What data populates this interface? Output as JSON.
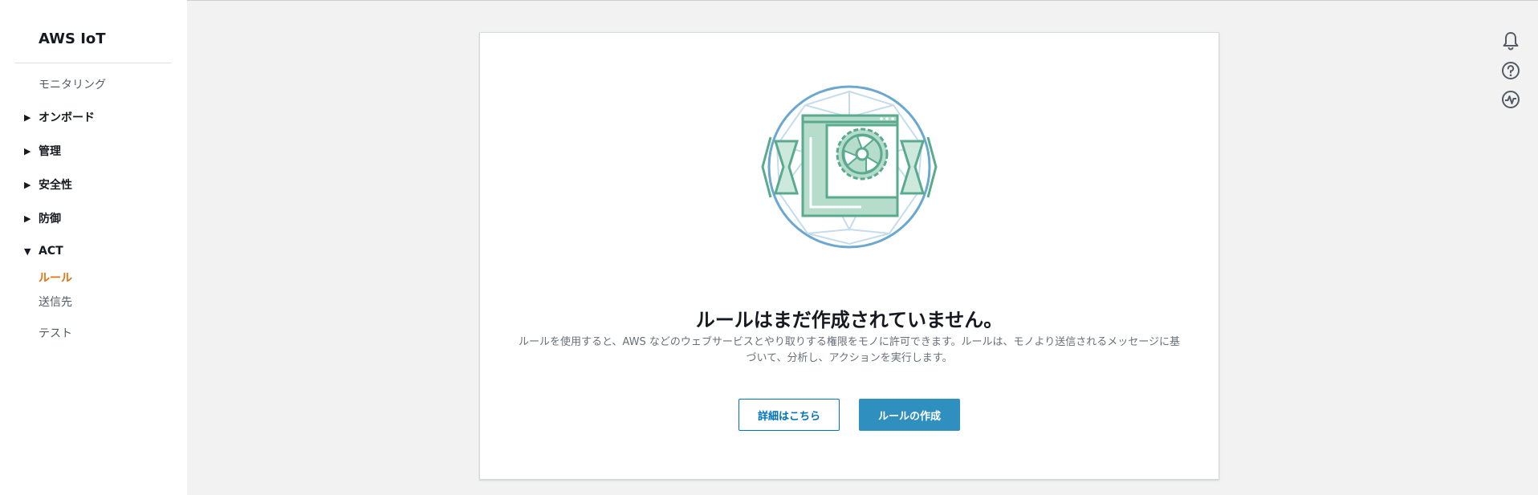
{
  "app": {
    "title": "AWS IoT"
  },
  "sidebar": {
    "monitoring": "モニタリング",
    "groups": [
      {
        "label": "オンボード",
        "expanded": false
      },
      {
        "label": "管理",
        "expanded": false
      },
      {
        "label": "安全性",
        "expanded": false
      },
      {
        "label": "防御",
        "expanded": false
      },
      {
        "label": "ACT",
        "expanded": true
      }
    ],
    "act_items": [
      {
        "label": "ルール",
        "active": true
      },
      {
        "label": "送信先",
        "active": false
      }
    ],
    "test": "テスト"
  },
  "empty_state": {
    "title": "ルールはまだ作成されていません。",
    "description": "ルールを使用すると、AWS などのウェブサービスとやり取りする権限をモノに許可できます。ルールは、モノより送信されるメッセージに基づいて、分析し、アクションを実行します。",
    "learn_more_label": "詳細はこちら",
    "create_rule_label": "ルールの作成"
  },
  "right_icons": [
    "bell-icon",
    "help-icon",
    "activity-icon"
  ],
  "colors": {
    "accent": "#ec7211",
    "primary_button": "#2f8fbf",
    "illustration_green": "#5aaa8e",
    "illustration_blue": "#6aa8d0"
  }
}
